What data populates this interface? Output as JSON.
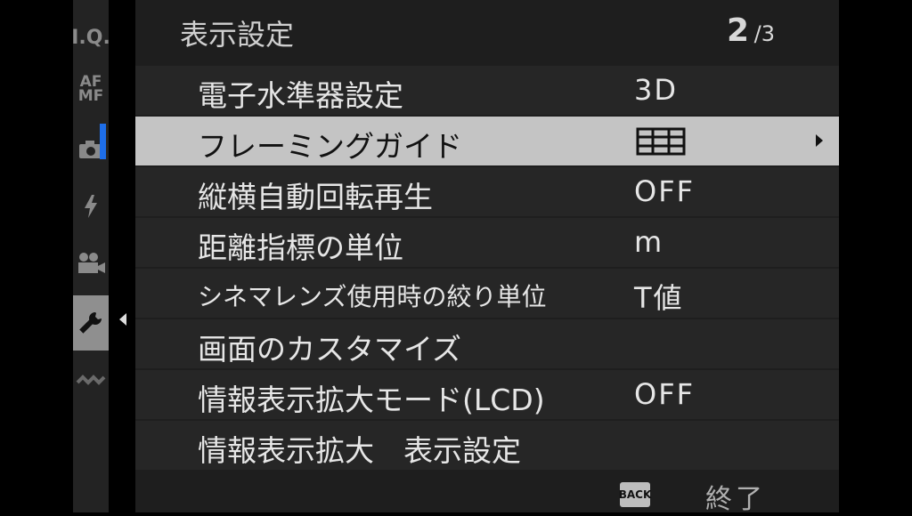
{
  "sidebar": {
    "items": [
      {
        "label": "I.Q.",
        "icon": "image-quality-icon"
      },
      {
        "label": "AF MF",
        "icon": "af-mf-icon"
      },
      {
        "label": "",
        "icon": "camera-icon"
      },
      {
        "label": "",
        "icon": "flash-icon"
      },
      {
        "label": "",
        "icon": "movie-icon"
      },
      {
        "label": "",
        "icon": "wrench-icon",
        "active": true
      },
      {
        "label": "",
        "icon": "wireless-icon"
      }
    ]
  },
  "header": {
    "title": "表示設定",
    "page_current": "2",
    "page_total": "/3"
  },
  "menu": {
    "items": [
      {
        "label": "電子水準器設定",
        "value": "3D"
      },
      {
        "label": "フレーミングガイド",
        "value_icon": "grid-9-icon",
        "selected": true
      },
      {
        "label": "縦横自動回転再生",
        "value": "OFF"
      },
      {
        "label": "距離指標の単位",
        "value": "m"
      },
      {
        "label": "シネマレンズ使用時の絞り単位",
        "value": "T値"
      },
      {
        "label": "画面のカスタマイズ",
        "value": ""
      },
      {
        "label": "情報表示拡大モード(LCD)",
        "value": "OFF"
      },
      {
        "label": "情報表示拡大　表示設定",
        "value": ""
      }
    ]
  },
  "footer": {
    "back_badge": "BACK",
    "back_label": "終了"
  },
  "colors": {
    "accent": "#1e6ee8",
    "selected_row": "#c4c4c4"
  }
}
